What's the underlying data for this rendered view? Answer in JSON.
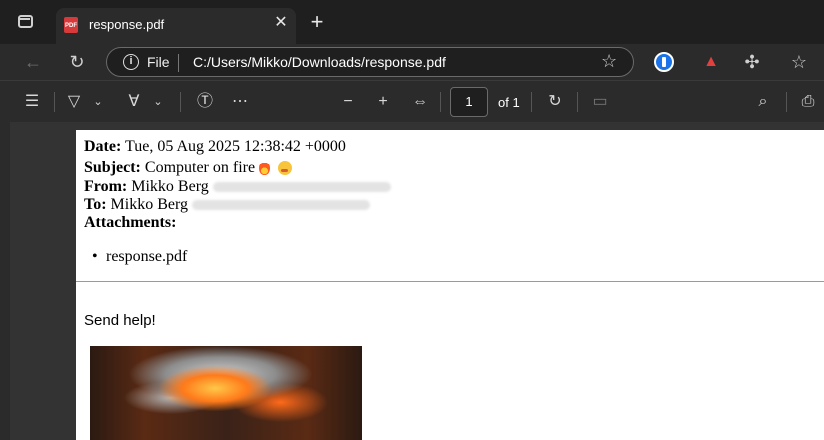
{
  "browser": {
    "tab": {
      "title": "response.pdf",
      "favicon": "pdf-icon"
    },
    "address": {
      "scheme_label": "File",
      "url": "C:/Users/Mikko/Downloads/response.pdf"
    }
  },
  "pdf_toolbar": {
    "page_number": "1",
    "page_total": "of 1"
  },
  "email": {
    "date_label": "Date:",
    "date_value": "Tue, 05 Aug 2025 12:38:42 +0000",
    "subject_label": "Subject:",
    "subject_value": "Computer on fire",
    "from_label": "From:",
    "from_value": "Mikko Berg",
    "to_label": "To:",
    "to_value": "Mikko Berg",
    "attachments_label": "Attachments:",
    "attachments": [
      "response.pdf"
    ],
    "body": "Send help!"
  }
}
